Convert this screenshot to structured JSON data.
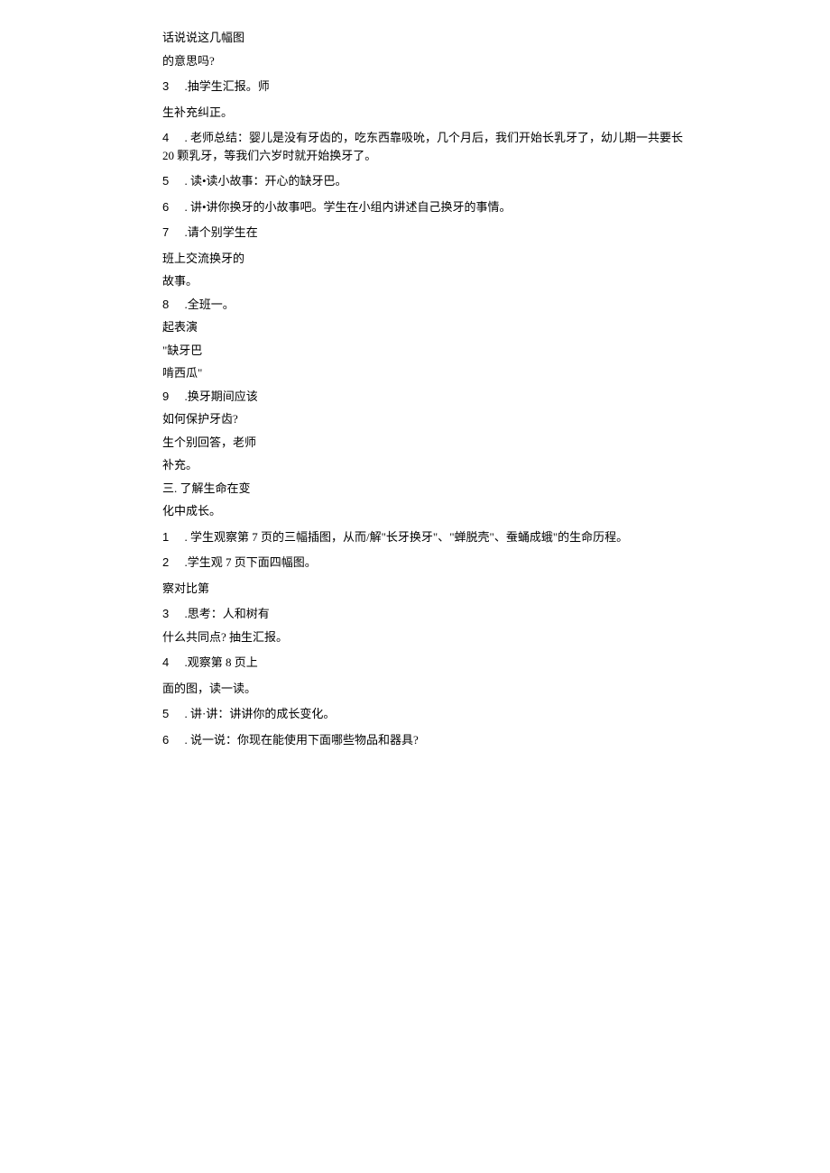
{
  "lines": {
    "l1": "话说说这几幅图",
    "l2": "的意思吗?",
    "l3_num": "3",
    "l3_text": ".抽学生汇报。师",
    "l4": "生补充纠正。",
    "l5_num": "4",
    "l5_text": ". 老师总结：婴儿是没有牙齿的，吃东西靠吸吮，几个月后，我们开始长乳牙了，幼儿期一共要长 20 颗乳牙，等我们六岁时就开始换牙了。",
    "l6_num": "5",
    "l6_text": ". 读•读小故事：开心的缺牙巴。",
    "l7_num": "6",
    "l7_text": ". 讲•讲你换牙的小故事吧。学生在小组内讲述自己换牙的事情。",
    "l8_num": "7",
    "l8_text": ".请个别学生在",
    "l9": "班上交流换牙的",
    "l10": "故事。",
    "l11_num": "8",
    "l11_text": ".全班一。",
    "l12": "起表演",
    "l13": "\"缺牙巴",
    "l14": "啃西瓜\"",
    "l15_num": "9",
    "l15_text": ".换牙期间应该",
    "l16": "如何保护牙齿?",
    "l17": "生个别回答，老师",
    "l18": "补充。",
    "l19": "三. 了解生命在变",
    "l20": "化中成长。",
    "l21_num": "1",
    "l21_text": ". 学生观察第 7 页的三幅插图，从而/解\"长牙换牙\"、\"蝉脱壳\"、蚕蛹成蛾\"的生命历程。",
    "l22_num": "2",
    "l22_text": ".学生观 7 页下面四幅图。",
    "l23": "察对比第",
    "l24_num": "3",
    "l24_text": ".思考：人和树有",
    "l25": "什么共同点? 抽生汇报。",
    "l26_num": "4",
    "l26_text": ".观察第 8 页上",
    "l27": "面的图，读一读。",
    "l28_num": "5",
    "l28_text": ". 讲·讲：讲讲你的成长变化。",
    "l29_num": "6",
    "l29_text": ". 说一说：你现在能使用下面哪些物品和器具?"
  }
}
